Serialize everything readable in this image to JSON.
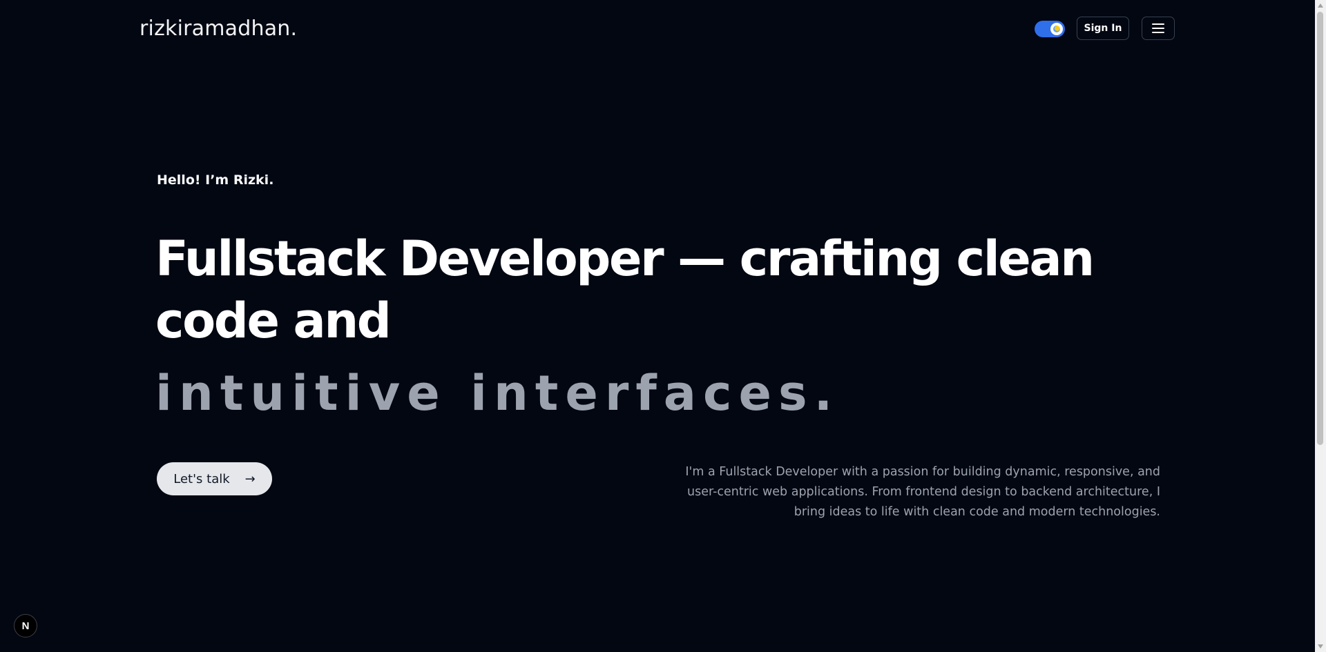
{
  "header": {
    "logo": "rizkiramadhan.",
    "signin_label": "Sign In",
    "theme_toggle_state": "on"
  },
  "hero": {
    "greeting": "Hello! I’m Rizki.",
    "headline": "Fullstack Developer — crafting clean code and",
    "headline_accent": "intuitive interfaces.",
    "cta_label": "Let's talk",
    "cta_arrow": "→",
    "bio": "I'm a Fullstack Developer with a passion for building dynamic, responsive, and user-centric web applications. From frontend design to backend architecture, I bring ideas to life with clean code and modern technologies."
  },
  "badge": {
    "label": "N"
  },
  "colors": {
    "background": "#030712",
    "toggle_accent": "#2f6fea",
    "muted_text": "#9ca3af",
    "cta_background": "#e5e7eb"
  },
  "icons": {
    "menu": "hamburger-menu-icon",
    "toggle": "theme-toggle-icon",
    "badge": "nextjs-logo-icon"
  }
}
